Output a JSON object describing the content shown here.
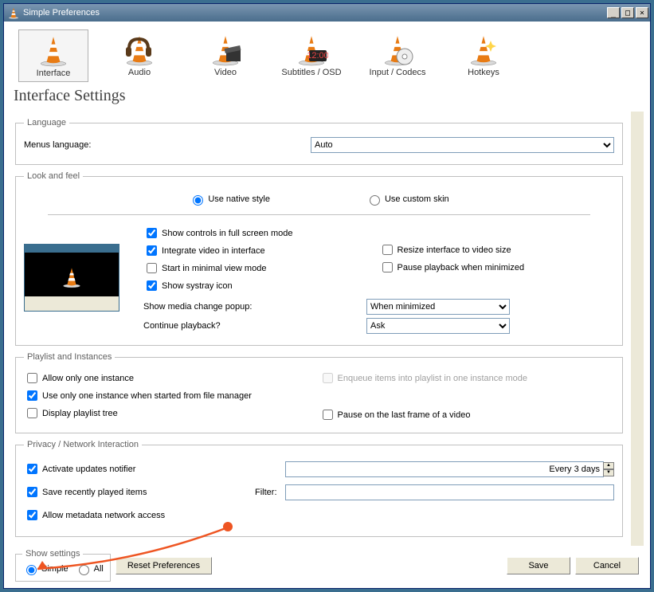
{
  "window": {
    "title": "Simple Preferences"
  },
  "tabs": [
    {
      "label": "Interface",
      "selected": true
    },
    {
      "label": "Audio"
    },
    {
      "label": "Video"
    },
    {
      "label": "Subtitles / OSD"
    },
    {
      "label": "Input / Codecs"
    },
    {
      "label": "Hotkeys"
    }
  ],
  "page_title": "Interface Settings",
  "language": {
    "legend": "Language",
    "menus_label": "Menus language:",
    "value": "Auto"
  },
  "look": {
    "legend": "Look and feel",
    "native": "Use native style",
    "custom": "Use custom skin",
    "chk_fullscreen": "Show controls in full screen mode",
    "chk_integrate": "Integrate video in interface",
    "chk_minimal": "Start in minimal view mode",
    "chk_systray": "Show systray icon",
    "chk_resize": "Resize interface to video size",
    "chk_pausemin": "Pause playback when minimized",
    "popup_label": "Show media change popup:",
    "popup_value": "When minimized",
    "continue_label": "Continue playback?",
    "continue_value": "Ask"
  },
  "playlist": {
    "legend": "Playlist and Instances",
    "one_instance": "Allow only one instance",
    "one_fm": "Use only one instance when started from file manager",
    "tree": "Display playlist tree",
    "enqueue": "Enqueue items into playlist in one instance mode",
    "pause_last": "Pause on the last frame of a video"
  },
  "privacy": {
    "legend": "Privacy / Network Interaction",
    "updates": "Activate updates notifier",
    "interval": "Every 3 days",
    "save_recent": "Save recently played items",
    "filter_label": "Filter:",
    "filter_value": "",
    "metadata": "Allow metadata network access"
  },
  "footer": {
    "show_settings": "Show settings",
    "simple": "Simple",
    "all": "All",
    "reset": "Reset Preferences",
    "save": "Save",
    "cancel": "Cancel"
  }
}
